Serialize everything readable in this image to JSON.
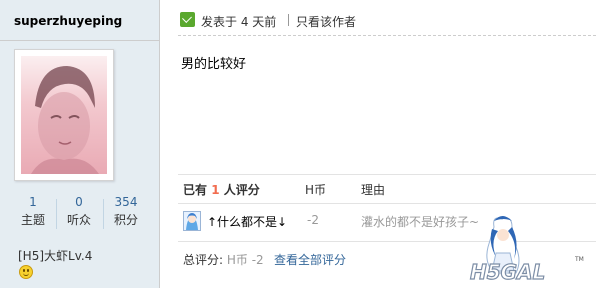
{
  "user": {
    "name": "superzhuyeping",
    "stats": [
      {
        "value": "1",
        "label": "主题"
      },
      {
        "value": "0",
        "label": "听众"
      },
      {
        "value": "354",
        "label": "积分"
      }
    ],
    "rank": "[H5]大虾Lv.4",
    "mood_icon": "smiley-icon"
  },
  "post": {
    "time": "发表于 4 天前",
    "author_only": "只看该作者",
    "content": "男的比较好"
  },
  "rating": {
    "prefix": "已有",
    "count": "1",
    "suffix": "人评分",
    "col_hcoin": "H币",
    "col_reason": "理由",
    "rows": [
      {
        "rater": "↑什么都不是↓",
        "value": "-2",
        "reason": "灌水的都不是好孩子~"
      }
    ],
    "total_label": "总评分:",
    "total_value": "H币 -2",
    "view_all": "查看全部评分"
  },
  "watermark": {
    "text": "H5GAL",
    "tm": "TM"
  }
}
